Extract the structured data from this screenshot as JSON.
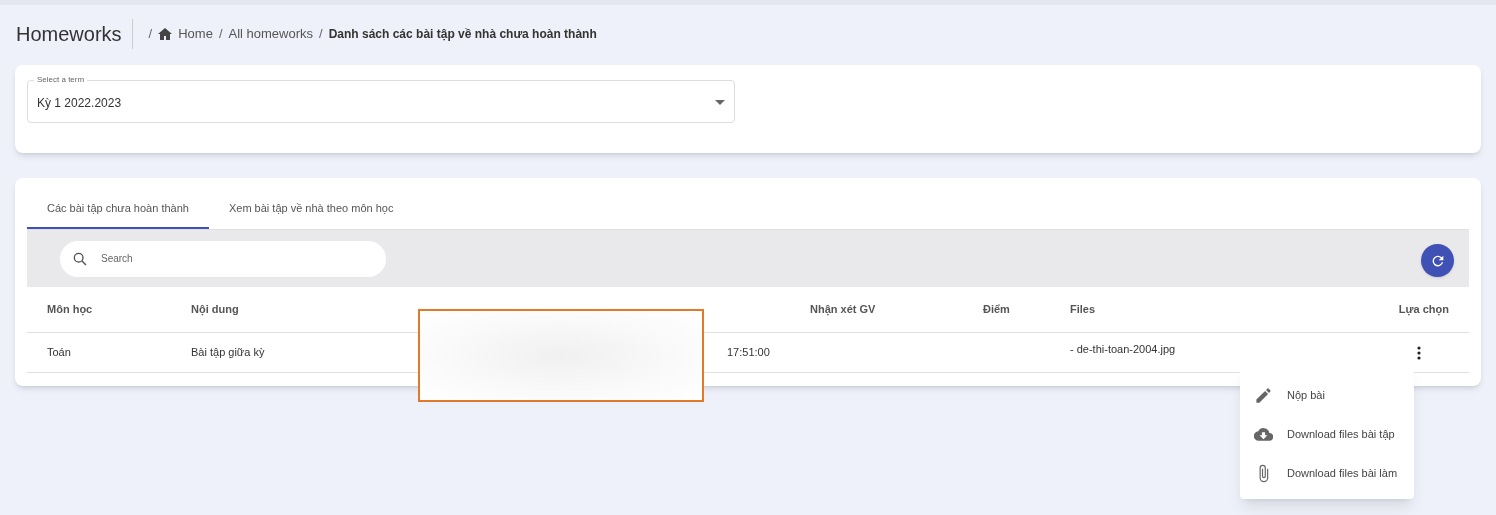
{
  "header": {
    "title": "Homeworks",
    "separator": "/",
    "breadcrumbs": [
      {
        "label": "Home",
        "kind": "home"
      },
      {
        "label": "All homeworks",
        "kind": "link"
      },
      {
        "label": "Danh sách các bài tập về nhà chưa hoàn thành",
        "kind": "current"
      }
    ]
  },
  "term_select": {
    "label": "Select a term",
    "value": "Kỳ 1 2022.2023"
  },
  "tabs": [
    {
      "label": "Các bài tập chưa hoàn thành",
      "selected": true
    },
    {
      "label": "Xem bài tập về nhà theo môn học",
      "selected": false
    }
  ],
  "search": {
    "placeholder": "Search"
  },
  "table": {
    "columns": [
      "Môn học",
      "Nội dung",
      "",
      "",
      "Nhận xét GV",
      "Điểm",
      "Files",
      "Lựa chọn"
    ],
    "rows": [
      {
        "cells": [
          "Toán",
          "Bài tập giữa kỳ",
          "",
          "17:51:00",
          "",
          "",
          "- de-thi-toan-2004.jpg"
        ]
      }
    ]
  },
  "menu": [
    {
      "label": "Nộp bài",
      "kind": "edit"
    },
    {
      "label": "Download files bài tập",
      "kind": "download"
    },
    {
      "label": "Download files bài làm",
      "kind": "attach"
    }
  ]
}
